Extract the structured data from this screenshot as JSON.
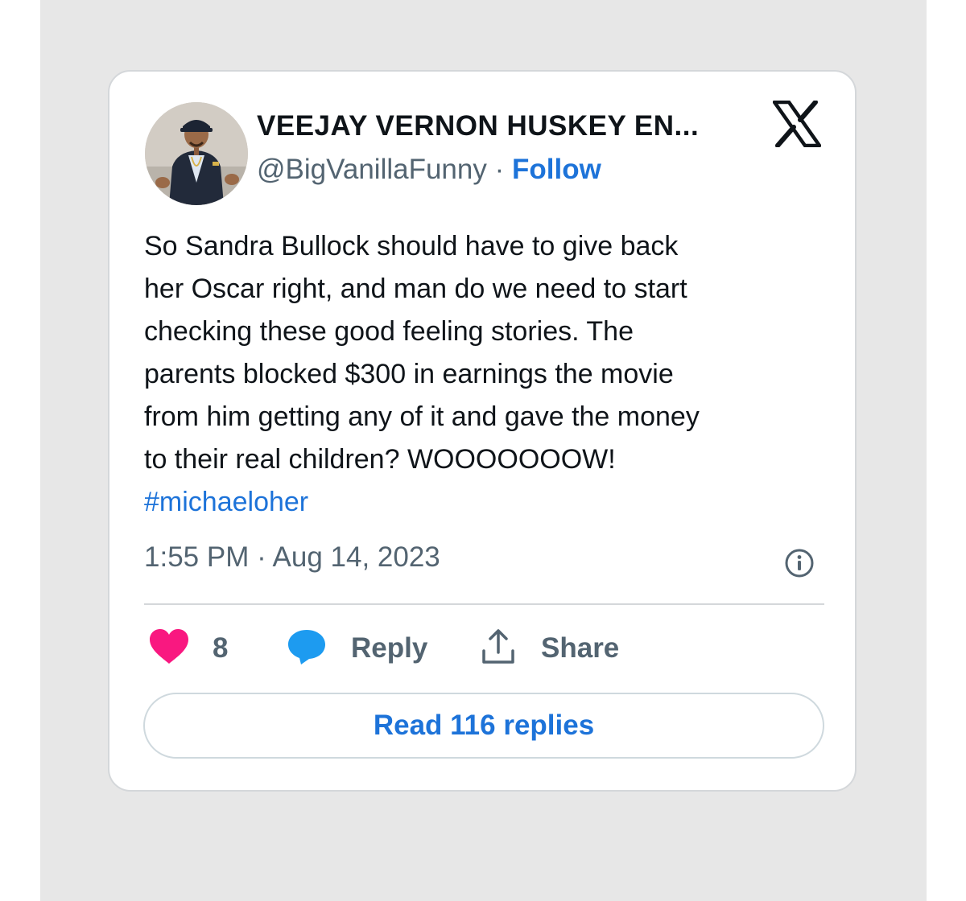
{
  "tweet": {
    "author": {
      "display_name": "VEEJAY VERNON HUSKEY EN...",
      "handle": "@BigVanillaFunny",
      "separator": "·",
      "follow_label": "Follow"
    },
    "text_lines": [
      "So Sandra Bullock should have to give back",
      "her Oscar right, and man do we need to start",
      "checking these good feeling stories. The",
      "parents blocked $300 in earnings the movie",
      "from him getting any of it and gave the money",
      "to their real children? WOOOOOOOW!"
    ],
    "hashtag": "#michaeloher",
    "timestamp": "1:55 PM · Aug 14, 2023",
    "actions": {
      "like_count": "8",
      "reply_label": "Reply",
      "share_label": "Share"
    },
    "read_replies_label": "Read 116 replies"
  },
  "icons": {
    "brand": "x-logo-icon",
    "info": "info-icon",
    "like": "heart-icon",
    "reply": "speech-bubble-icon",
    "share": "share-upload-icon"
  },
  "colors": {
    "link_blue": "#1d73d9",
    "heart_pink": "#f91880",
    "reply_blue": "#1d9bf0",
    "secondary_text": "#536471",
    "primary_text": "#0f1419",
    "background_gray": "#e7e7e7"
  }
}
